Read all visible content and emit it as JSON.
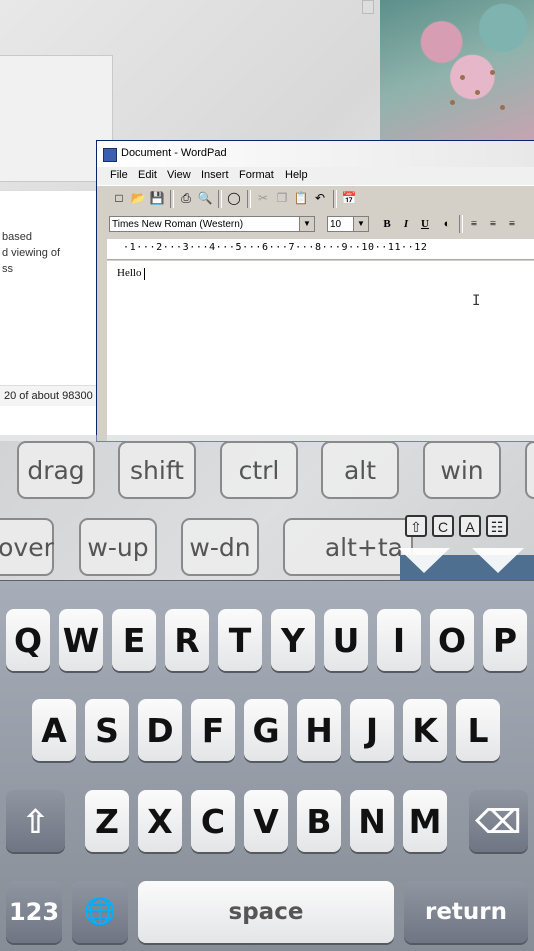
{
  "browser": {
    "snippet_lines": [
      "based",
      "d viewing of",
      "ss"
    ],
    "results_text": "20 of about 98300"
  },
  "wordpad": {
    "title": "Document - WordPad",
    "menus": [
      "File",
      "Edit",
      "View",
      "Insert",
      "Format",
      "Help"
    ],
    "font_name": "Times New Roman (Western)",
    "font_size": "10",
    "format_buttons": {
      "bold": "B",
      "italic": "I",
      "underline": "U"
    },
    "ruler_text": "·1···2···3···4···5···6···7···8···9··10··11··12",
    "document_text": "Hello"
  },
  "modifier_keys": [
    "drag",
    "shift",
    "ctrl",
    "alt",
    "win"
  ],
  "window_keys": [
    "over",
    "w-up",
    "w-dn",
    "alt+ta"
  ],
  "mode_icons": [
    "⇧",
    "C",
    "A",
    "☷"
  ],
  "keyboard": {
    "row1": [
      "Q",
      "W",
      "E",
      "R",
      "T",
      "Y",
      "U",
      "I",
      "O",
      "P"
    ],
    "row2": [
      "A",
      "S",
      "D",
      "F",
      "G",
      "H",
      "J",
      "K",
      "L"
    ],
    "row3": [
      "Z",
      "X",
      "C",
      "V",
      "B",
      "N",
      "M"
    ],
    "shift": "⇧",
    "backspace": "⌫",
    "numbers": "123",
    "globe": "🌐",
    "space": "space",
    "return": "return"
  }
}
